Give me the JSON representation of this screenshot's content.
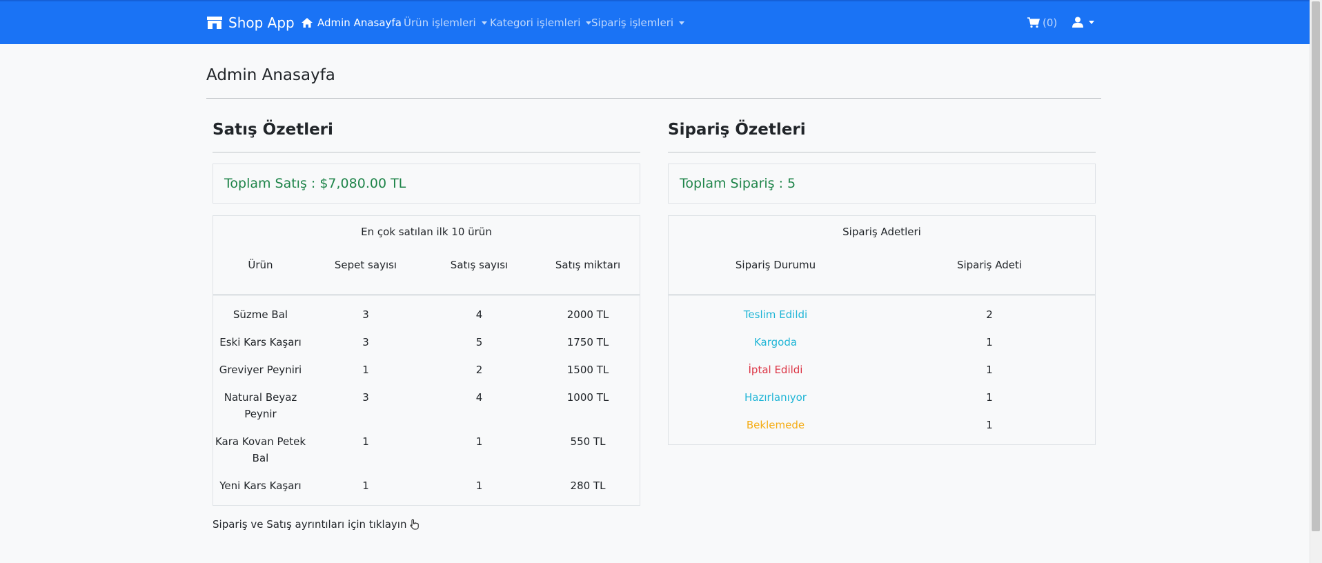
{
  "navbar": {
    "brand": "Shop App",
    "items": [
      {
        "label": "Admin Anasayfa"
      },
      {
        "label": "Ürün işlemleri"
      },
      {
        "label": "Kategori işlemleri"
      },
      {
        "label": "Sipariş işlemleri"
      }
    ],
    "cart_label": "(0)",
    "bg_color": "#1a73f5"
  },
  "page": {
    "title": "Admin Anasayfa"
  },
  "sales": {
    "title": "Satış Özetleri",
    "total": "Toplam Satış : $7,080.00 TL",
    "table": {
      "caption": "En çok satılan ilk 10 ürün",
      "headers": [
        "Ürün",
        "Sepet sayısı",
        "Satış sayısı",
        "Satış miktarı"
      ],
      "rows": [
        {
          "product": "Süzme Bal",
          "cart": "3",
          "sales": "4",
          "amount": "2000 TL"
        },
        {
          "product": "Eski Kars Kaşarı",
          "cart": "3",
          "sales": "5",
          "amount": "1750 TL"
        },
        {
          "product": "Greviyer Peyniri",
          "cart": "1",
          "sales": "2",
          "amount": "1500 TL"
        },
        {
          "product_line1": "Natural Beyaz",
          "product_line2": "Peynir",
          "cart": "3",
          "sales": "4",
          "amount": "1000 TL"
        },
        {
          "product_line1": "Kara Kovan Petek",
          "product_line2": "Bal",
          "cart": "1",
          "sales": "1",
          "amount": "550 TL"
        },
        {
          "product": "Yeni Kars Kaşarı",
          "cart": "1",
          "sales": "1",
          "amount": "280 TL"
        }
      ]
    }
  },
  "orders": {
    "title": "Sipariş Özetleri",
    "total": "Toplam Sipariş : 5",
    "table": {
      "caption": "Sipariş Adetleri",
      "headers": [
        "Sipariş Durumu",
        "Sipariş Adeti"
      ],
      "rows": [
        {
          "status": "Teslim Edildi",
          "count": "2"
        },
        {
          "status": "Kargoda",
          "count": "1"
        },
        {
          "status": "İptal Edildi",
          "count": "1"
        },
        {
          "status": "Hazırlanıyor",
          "count": "1"
        },
        {
          "status": "Beklemede",
          "count": "1"
        }
      ]
    }
  },
  "footer": {
    "link_text": "Sipariş ve Satış ayrıntıları için tıklayın"
  },
  "colors": {
    "success": "#1e8449",
    "info": "#1fb5d6",
    "danger": "#dc3545",
    "warning": "#f5ac13"
  }
}
